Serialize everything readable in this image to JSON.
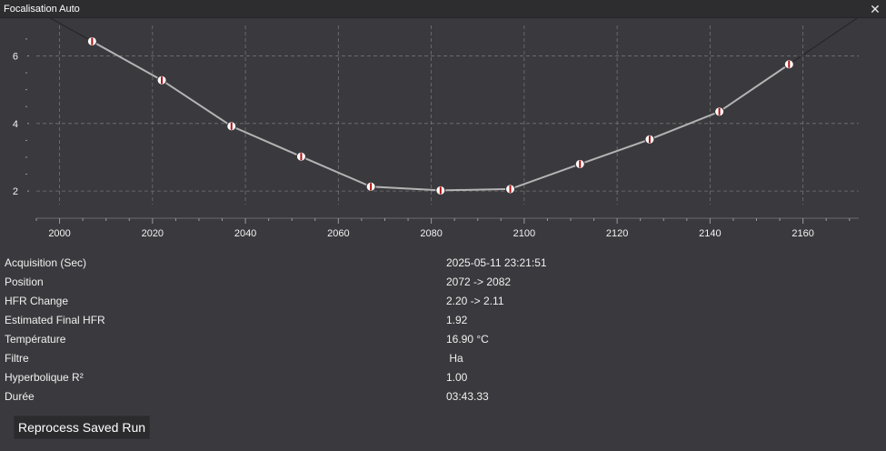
{
  "window": {
    "title": "Focalisation Auto",
    "close_icon": "close-icon"
  },
  "chart_data": {
    "type": "scatter",
    "title": "",
    "xlabel": "",
    "ylabel": "",
    "xlim": [
      1995,
      2172
    ],
    "ylim": [
      1.6,
      6.9
    ],
    "x_ticks": [
      2000,
      2020,
      2040,
      2060,
      2080,
      2100,
      2120,
      2140,
      2160
    ],
    "y_ticks": [
      2,
      4,
      6
    ],
    "grid": true,
    "series": [
      {
        "points": [
          {
            "x": 2007,
            "y": 6.43
          },
          {
            "x": 2022,
            "y": 5.28
          },
          {
            "x": 2037,
            "y": 3.92
          },
          {
            "x": 2052,
            "y": 3.02
          },
          {
            "x": 2067,
            "y": 2.13
          },
          {
            "x": 2082,
            "y": 2.02
          },
          {
            "x": 2097,
            "y": 2.06
          },
          {
            "x": 2112,
            "y": 2.8
          },
          {
            "x": 2127,
            "y": 3.53
          },
          {
            "x": 2142,
            "y": 4.35
          },
          {
            "x": 2157,
            "y": 5.75
          }
        ]
      }
    ],
    "colors": {
      "line": "#b4b4b4",
      "marker_fill": "#ffffff",
      "marker_accent": "#b01010",
      "grid": "#8c8c8c",
      "plot_bg": "#3a3a3e",
      "fit_line": "#1e1e1e"
    }
  },
  "info": {
    "rows": [
      {
        "label": "Acquisition (Sec)",
        "value": "2025-05-11 23:21:51"
      },
      {
        "label": "Position",
        "value": "2072 -> 2082"
      },
      {
        "label": "HFR Change",
        "value": "2.20 -> 2.11"
      },
      {
        "label": "Estimated Final HFR",
        "value": "1.92"
      },
      {
        "label": "Température",
        "value": "16.90 °C"
      },
      {
        "label": "Filtre",
        "value": " Ha"
      },
      {
        "label": "Hyperbolique R²",
        "value": "1.00"
      },
      {
        "label": "Durée",
        "value": "03:43.33"
      }
    ]
  },
  "actions": {
    "reprocess_label": "Reprocess Saved Run"
  }
}
